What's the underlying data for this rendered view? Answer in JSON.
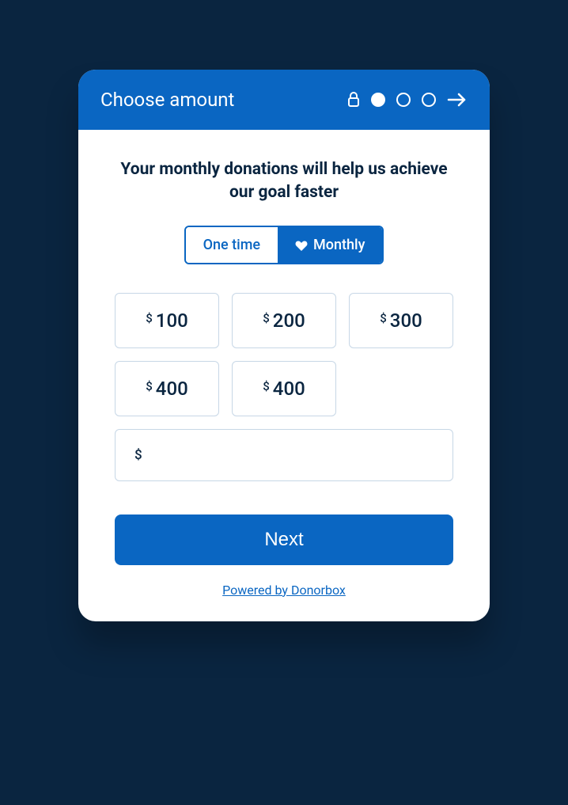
{
  "header": {
    "title": "Choose amount"
  },
  "headline": "Your monthly donations will help us achieve our goal faster",
  "frequency": {
    "onetime_label": "One time",
    "monthly_label": "Monthly"
  },
  "currency_symbol": "$",
  "amounts": [
    {
      "value": "100"
    },
    {
      "value": "200"
    },
    {
      "value": "300"
    },
    {
      "value": "400"
    },
    {
      "value": "400"
    }
  ],
  "next_label": "Next",
  "powered_label": "Powered by Donorbox",
  "colors": {
    "brand": "#0a66c2",
    "bg_dark": "#0a2540",
    "border": "#c7d7e6"
  }
}
